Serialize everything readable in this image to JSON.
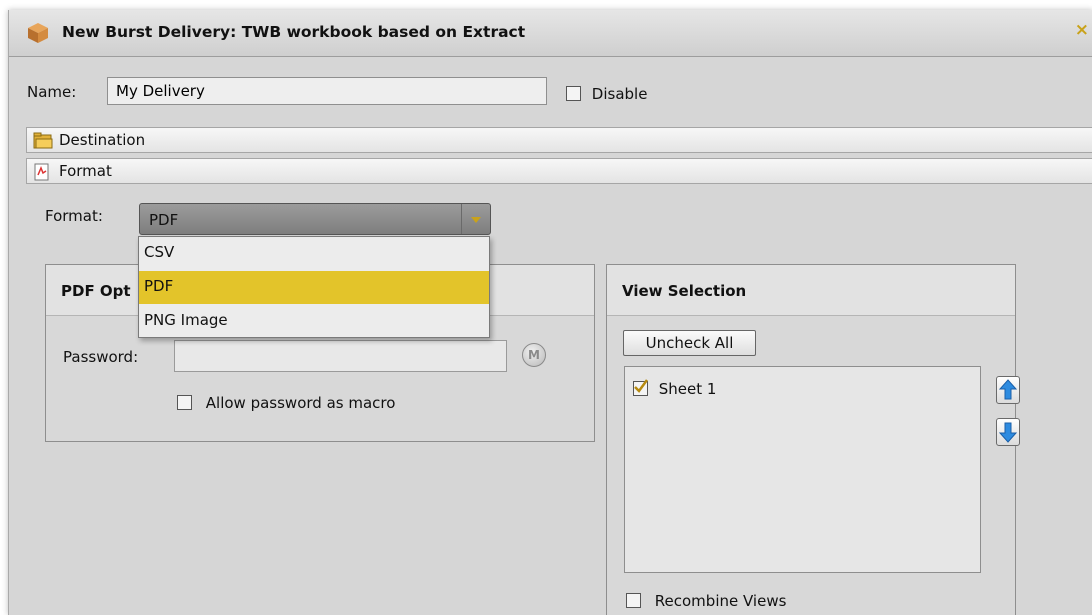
{
  "window": {
    "title": "New Burst Delivery: TWB workbook based on Extract",
    "close_symbol": "×",
    "icon": "package-icon"
  },
  "name_field": {
    "label": "Name:",
    "value": "My Delivery"
  },
  "disable_checkbox": {
    "label": "Disable",
    "checked": false
  },
  "sections": {
    "destination": {
      "label": "Destination",
      "icon": "folder-icon"
    },
    "format": {
      "label": "Format",
      "icon": "pdf-file-icon"
    }
  },
  "format_select": {
    "label": "Format:",
    "value": "PDF",
    "options": [
      "CSV",
      "PDF",
      "PNG Image"
    ],
    "selected_index": 1
  },
  "pdf_options": {
    "title": "PDF Opt",
    "password_label": "Password:",
    "password_value": "",
    "macro_button_label": "M",
    "allow_macro_label": "Allow password as macro",
    "allow_macro_checked": false
  },
  "view_selection": {
    "title": "View Selection",
    "uncheck_all_label": "Uncheck All",
    "sheets": [
      {
        "label": "Sheet 1",
        "checked": true
      }
    ],
    "recombine_label": "Recombine Views",
    "recombine_checked": false
  },
  "colors": {
    "accent": "#e3c42a",
    "arrow_blue": "#2d8be0",
    "check_gold": "#b68a10"
  }
}
